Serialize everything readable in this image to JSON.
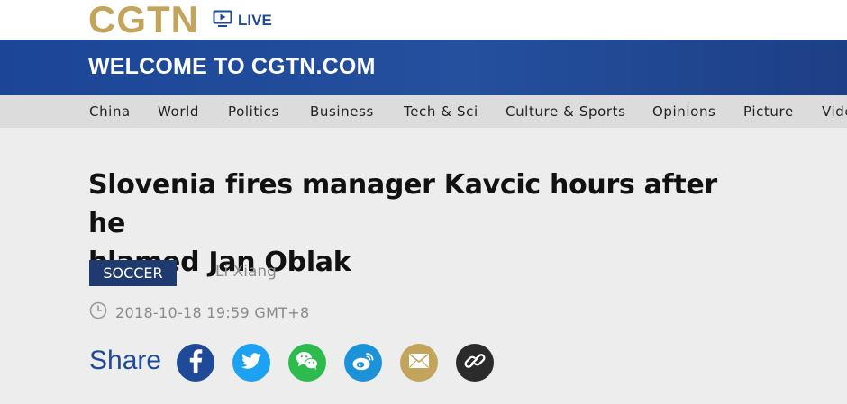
{
  "header": {
    "logo_text": "CGTN",
    "live_label": "LIVE",
    "banner_title": "WELCOME TO CGTN.COM"
  },
  "nav": {
    "items": [
      "China",
      "World",
      "Politics",
      "Business",
      "Tech & Sci",
      "Culture & Sports",
      "Opinions",
      "Picture",
      "Video"
    ]
  },
  "article": {
    "headline_line1": "Slovenia fires manager Kavcic hours after he",
    "headline_line2": "blamed Jan Oblak",
    "category_tag": "SOCCER",
    "author": "Li Xiang",
    "timestamp": "2018-10-18 19:59 GMT+8"
  },
  "share": {
    "label": "Share",
    "buttons": [
      {
        "name": "facebook",
        "icon": "facebook-icon",
        "color": "#1f4a97"
      },
      {
        "name": "twitter",
        "icon": "twitter-icon",
        "color": "#1da1f2"
      },
      {
        "name": "wechat",
        "icon": "wechat-icon",
        "color": "#2dbb4e"
      },
      {
        "name": "weibo",
        "icon": "weibo-icon",
        "color": "#1c93d8"
      },
      {
        "name": "email",
        "icon": "email-icon",
        "color": "#c2a45a"
      },
      {
        "name": "link",
        "icon": "link-icon",
        "color": "#2b2b2b"
      }
    ]
  },
  "colors": {
    "brand_gold": "#c2a45a",
    "brand_blue": "#1f4a97",
    "tag_navy": "#1f3a6e"
  }
}
